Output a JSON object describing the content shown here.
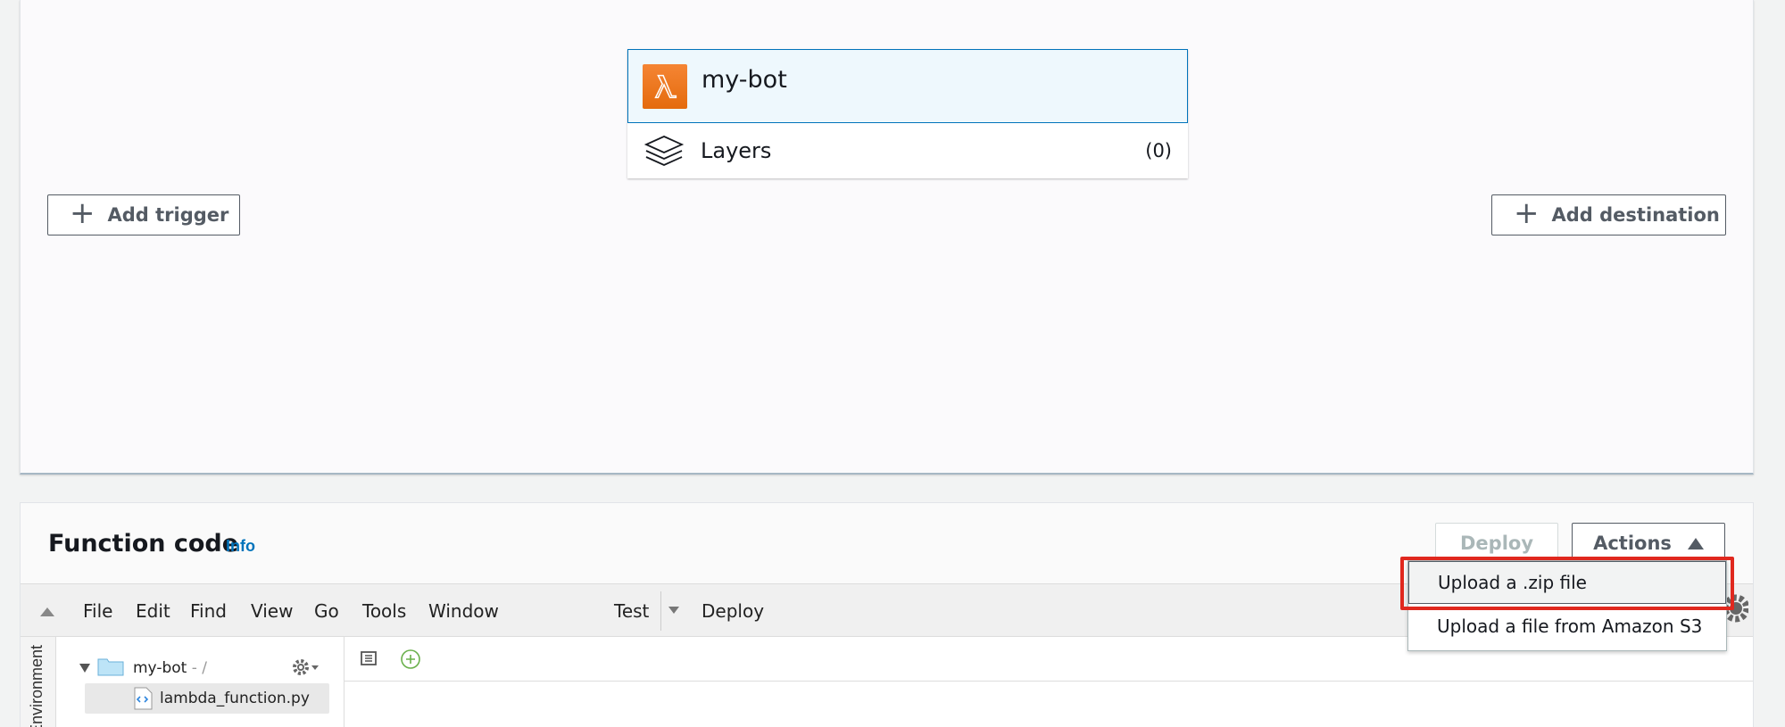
{
  "designer": {
    "function_name": "my-bot",
    "layers_label": "Layers",
    "layers_count": "(0)",
    "add_trigger_label": "Add trigger",
    "add_destination_label": "Add destination",
    "icons": {
      "function": "lambda-icon",
      "layers": "layers-icon",
      "plus": "plus-icon"
    }
  },
  "function_code": {
    "title": "Function code",
    "info_link": "Info",
    "deploy_label": "Deploy",
    "actions_label": "Actions",
    "toolbar": {
      "menu": [
        "File",
        "Edit",
        "Find",
        "View",
        "Go",
        "Tools",
        "Window"
      ],
      "test_label": "Test",
      "deploy_label": "Deploy"
    },
    "environment_label": "Environment",
    "tree": {
      "root": "my-bot",
      "root_suffix": " - /",
      "file": "lambda_function.py"
    }
  },
  "actions_menu": {
    "items": [
      "Upload a .zip file",
      "Upload a file from Amazon S3"
    ],
    "highlighted_index": 0
  },
  "colors": {
    "lambda_orange": "#e46b0c",
    "link_blue": "#0073bb",
    "highlight_red": "#e0281e",
    "selected_border": "#0073bb"
  }
}
